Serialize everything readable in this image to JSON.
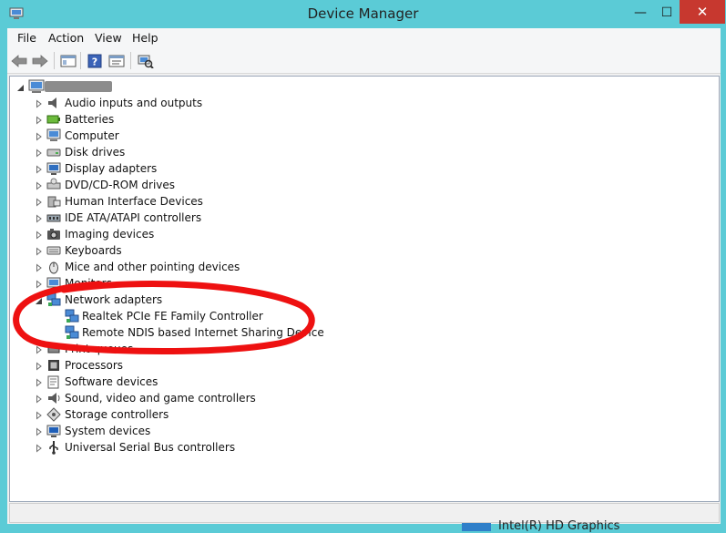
{
  "window": {
    "title": "Device Manager",
    "minimize_glyph": "—",
    "maximize_glyph": "☐",
    "close_glyph": "✕"
  },
  "menu": [
    "File",
    "Action",
    "View",
    "Help"
  ],
  "toolbar": {
    "buttons": [
      "back-arrow-icon",
      "forward-arrow-icon",
      "show-hide-console-tree-icon",
      "help-icon",
      "properties-icon",
      "scan-hardware-icon"
    ]
  },
  "tree": {
    "categories": [
      {
        "label": "Audio inputs and outputs",
        "icon": "speaker-icon"
      },
      {
        "label": "Batteries",
        "icon": "battery-icon"
      },
      {
        "label": "Computer",
        "icon": "computer-icon"
      },
      {
        "label": "Disk drives",
        "icon": "disk-drive-icon"
      },
      {
        "label": "Display adapters",
        "icon": "display-adapter-icon"
      },
      {
        "label": "DVD/CD-ROM drives",
        "icon": "dvd-drive-icon"
      },
      {
        "label": "Human Interface Devices",
        "icon": "hid-icon"
      },
      {
        "label": "IDE ATA/ATAPI controllers",
        "icon": "ide-controller-icon"
      },
      {
        "label": "Imaging devices",
        "icon": "camera-icon"
      },
      {
        "label": "Keyboards",
        "icon": "keyboard-icon"
      },
      {
        "label": "Mice and other pointing devices",
        "icon": "mouse-icon"
      },
      {
        "label": "Monitors",
        "icon": "monitor-icon"
      },
      {
        "label": "Network adapters",
        "icon": "network-adapter-icon",
        "expanded": true,
        "children": [
          "Realtek PCIe FE Family Controller",
          "Remote NDIS based Internet Sharing Device"
        ]
      },
      {
        "label": "Print queues",
        "icon": "printer-icon"
      },
      {
        "label": "Processors",
        "icon": "processor-icon"
      },
      {
        "label": "Software devices",
        "icon": "software-device-icon"
      },
      {
        "label": "Sound, video and game controllers",
        "icon": "sound-icon"
      },
      {
        "label": "Storage controllers",
        "icon": "storage-controller-icon"
      },
      {
        "label": "System devices",
        "icon": "system-devices-icon"
      },
      {
        "label": "Universal Serial Bus controllers",
        "icon": "usb-icon"
      }
    ]
  },
  "background_text": "Intel(R) HD Graphics",
  "colors": {
    "frame": "#5bcbd6",
    "close_button": "#c7382f",
    "annotation_circle": "#ee1111"
  }
}
